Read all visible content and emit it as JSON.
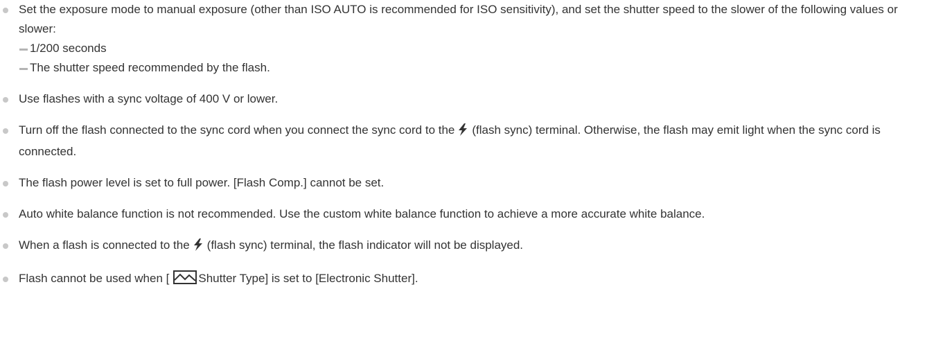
{
  "notes": [
    {
      "text": "Set the exposure mode to manual exposure (other than ISO AUTO is recommended for ISO sensitivity), and set the shutter speed to the slower of the following values or slower:",
      "subs": [
        "1/200 seconds",
        "The shutter speed recommended by the flash."
      ]
    },
    {
      "text": "Use flashes with a sync voltage of 400 V or lower."
    },
    {
      "before": "Turn off the flash connected to the sync cord when you connect the sync cord to the",
      "after": "(flash sync) terminal. Otherwise, the flash may emit light when the sync cord is connected.",
      "icon": "flash-sync-icon"
    },
    {
      "text": "The flash power level is set to full power. [Flash Comp.] cannot be set."
    },
    {
      "text": "Auto white balance function is not recommended. Use the custom white balance function to achieve a more accurate white balance."
    },
    {
      "before": "When a flash is connected to the",
      "after": "(flash sync) terminal, the flash indicator will not be displayed.",
      "icon": "flash-sync-icon"
    },
    {
      "before": "Flash cannot be used when [",
      "after": "Shutter Type] is set to [Electronic Shutter].",
      "icon": "shutter-type-icon"
    }
  ],
  "colors": {
    "text": "#333333",
    "bullet": "#c8c8c8",
    "dash": "#b4b4b4"
  }
}
